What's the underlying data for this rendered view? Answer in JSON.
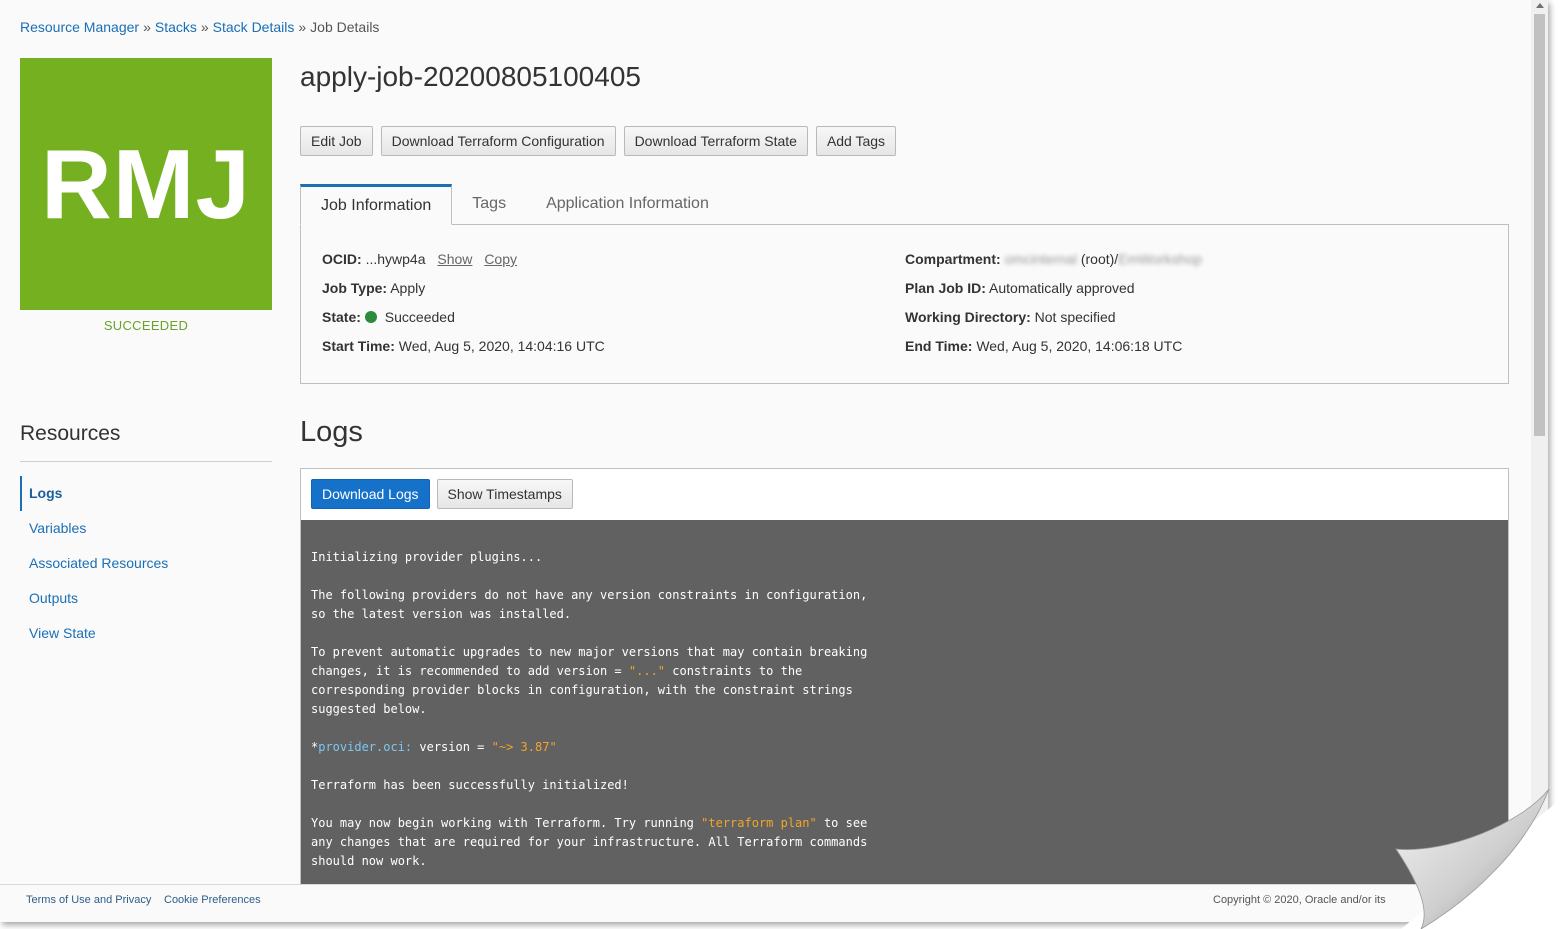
{
  "breadcrumb": {
    "items": [
      "Resource Manager",
      "Stacks",
      "Stack Details"
    ],
    "separator": "»",
    "current": "Job Details"
  },
  "logo": {
    "text": "RMJ",
    "color": "#75b021"
  },
  "status_label": "SUCCEEDED",
  "job": {
    "title": "apply-job-20200805100405"
  },
  "actions": {
    "edit": "Edit Job",
    "download_config": "Download Terraform Configuration",
    "download_state": "Download Terraform State",
    "add_tags": "Add Tags"
  },
  "tabs": [
    "Job Information",
    "Tags",
    "Application Information"
  ],
  "info": {
    "ocid_label": "OCID:",
    "ocid_value": "...hywp4a",
    "ocid_show": "Show",
    "ocid_copy": "Copy",
    "job_type_label": "Job Type:",
    "job_type_value": "Apply",
    "state_label": "State:",
    "state_value": "Succeeded",
    "start_label": "Start Time:",
    "start_value": "Wed, Aug 5, 2020, 14:04:16 UTC",
    "compartment_label": "Compartment:",
    "compartment_tenant": "omcinternal",
    "compartment_root": "(root)/",
    "compartment_name": "EmWorkshop",
    "plan_label": "Plan Job ID:",
    "plan_value": "Automatically approved",
    "workdir_label": "Working Directory:",
    "workdir_value": "Not specified",
    "end_label": "End Time:",
    "end_value": "Wed, Aug 5, 2020, 14:06:18 UTC"
  },
  "resources": {
    "title": "Resources",
    "items": [
      "Logs",
      "Variables",
      "Associated Resources",
      "Outputs",
      "View State"
    ]
  },
  "logs": {
    "title": "Logs",
    "download": "Download Logs",
    "timestamps": "Show Timestamps",
    "lines": {
      "l1": "Initializing provider plugins...",
      "l2": "",
      "l3": "The following providers do not have any version constraints in configuration,",
      "l4": "so the latest version was installed.",
      "l5": "",
      "l6": "To prevent automatic upgrades to new major versions that may contain breaking",
      "l7a": "changes, it is recommended to add version = ",
      "l7b": "\"...\"",
      "l7c": " constraints to the",
      "l8": "corresponding provider blocks in configuration, with the constraint strings",
      "l9": "suggested below.",
      "l10": "",
      "l11a": "*",
      "l11b": "provider.oci:",
      "l11c": " version = ",
      "l11d": "\"~> 3.87\"",
      "l12": "",
      "l13": "Terraform has been successfully initialized!",
      "l14": "",
      "l15a": "You may now begin working with Terraform. Try running ",
      "l15b": "\"terraform plan\"",
      "l15c": " to see",
      "l16": "any changes that are required for your infrastructure. All Terraform commands",
      "l17": "should now work."
    }
  },
  "footer": {
    "terms": "Terms of Use and Privacy",
    "cookies": "Cookie Preferences",
    "copyright": "Copyright © 2020, Oracle and/or its"
  }
}
